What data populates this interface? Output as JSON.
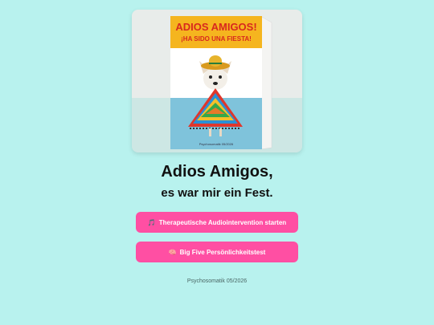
{
  "card": {
    "headline": "ADIOS AMIGOS!",
    "subline": "¡HA SIDO UNA FIESTA!",
    "imprint": "Psychosomatik 05/2026"
  },
  "heading": {
    "title": "Adios Amigos,",
    "subtitle": "es war mir ein Fest."
  },
  "buttons": [
    {
      "icon": "music-note-icon",
      "glyph": "🎵",
      "label": "Therapeutische Audiointervention starten"
    },
    {
      "icon": "brain-icon",
      "glyph": "🧠",
      "label": "Big Five Persönlichkeitstest"
    }
  ],
  "footer": {
    "text": "Psychosomatik 05/2026"
  },
  "colors": {
    "background": "#b8f2ee",
    "button": "#ff4fa3",
    "card_banner": "#f5b51f",
    "card_headline": "#d8281e"
  }
}
